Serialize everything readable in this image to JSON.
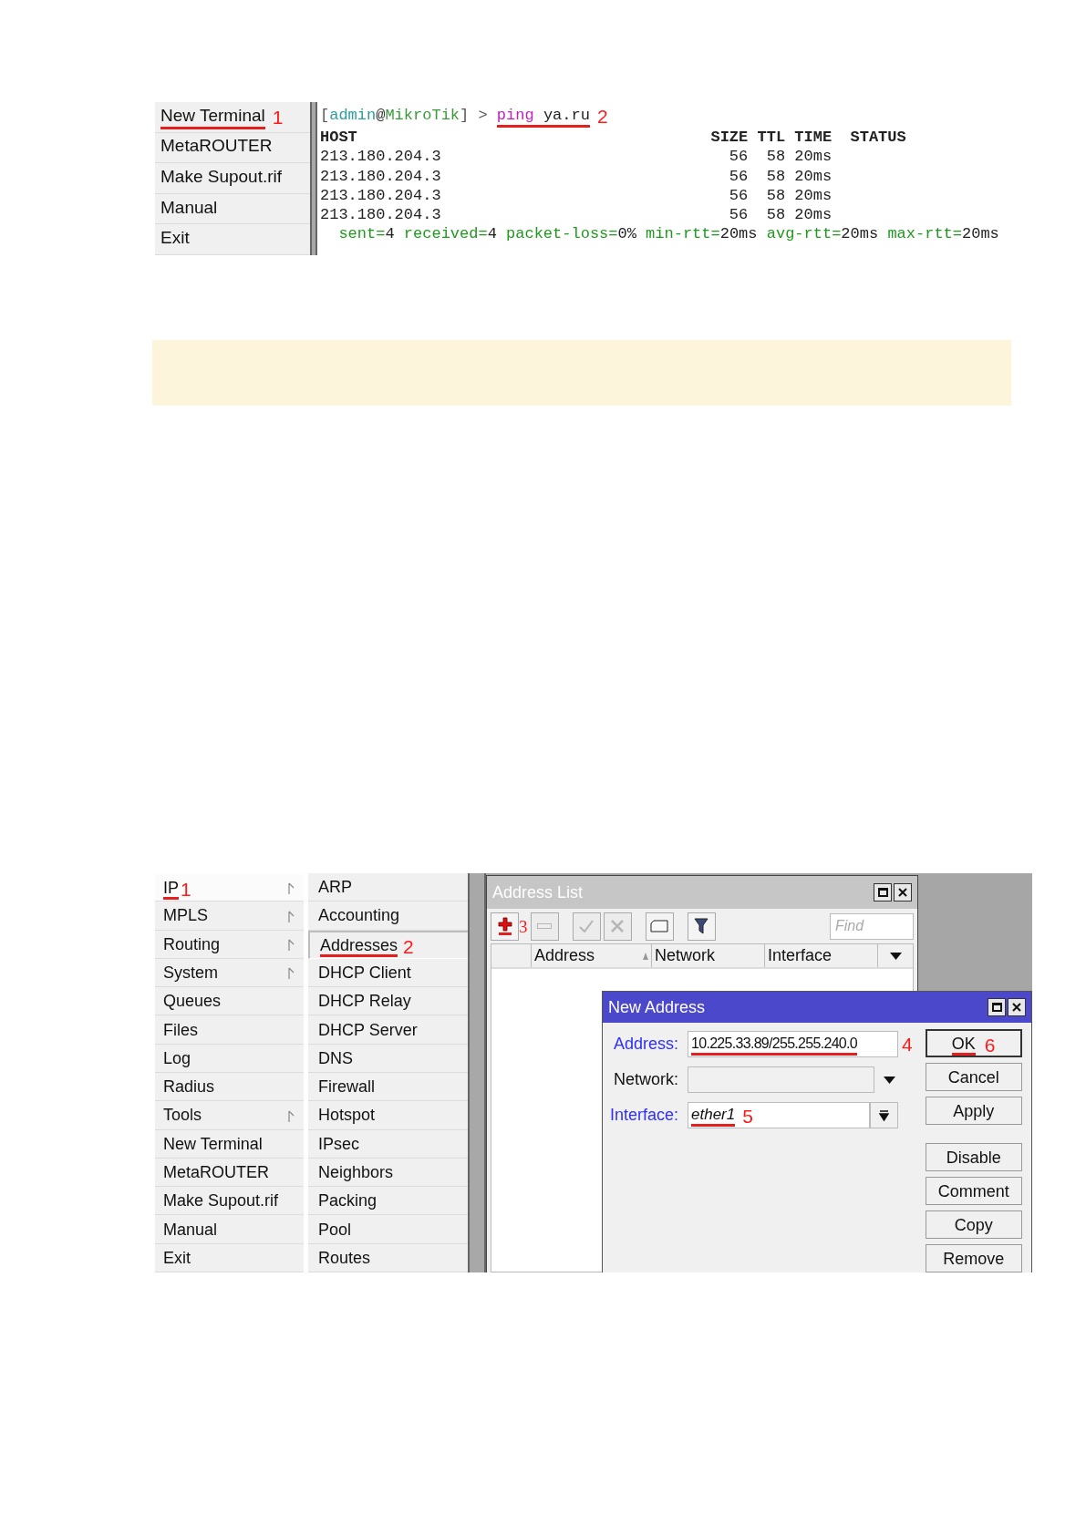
{
  "top_screenshot": {
    "menu": [
      {
        "label": "New Terminal",
        "underlined": true,
        "mark": "1"
      },
      {
        "label": "MetaROUTER",
        "underlined": false
      },
      {
        "label": "Make Supout.rif",
        "underlined": false
      },
      {
        "label": "Manual",
        "underlined": false
      },
      {
        "label": "Exit",
        "underlined": false
      }
    ],
    "terminal": {
      "prompt": [
        {
          "kind": "bracket",
          "text": "["
        },
        {
          "kind": "user",
          "text": "admin"
        },
        {
          "kind": "punct",
          "text": "@"
        },
        {
          "kind": "host",
          "text": "MikroTik"
        },
        {
          "kind": "bracket",
          "text": "] > "
        }
      ],
      "command": {
        "keyword": "ping",
        "argument": "ya.ru",
        "underlined": true,
        "mark": "2"
      },
      "columns": [
        "HOST",
        "SIZE",
        "TTL",
        "TIME",
        "STATUS"
      ],
      "rows": [
        {
          "host": "213.180.204.3",
          "size": "56",
          "ttl": "58",
          "time": "20ms"
        },
        {
          "host": "213.180.204.3",
          "size": "56",
          "ttl": "58",
          "time": "20ms"
        },
        {
          "host": "213.180.204.3",
          "size": "56",
          "ttl": "58",
          "time": "20ms"
        },
        {
          "host": "213.180.204.3",
          "size": "56",
          "ttl": "58",
          "time": "20ms"
        }
      ],
      "summary": [
        {
          "key": "sent=",
          "value": "4"
        },
        {
          "key": "received=",
          "value": "4"
        },
        {
          "key": "packet-loss=",
          "value": "0%"
        },
        {
          "key": "min-rtt=",
          "value": "20ms"
        },
        {
          "key": "avg-rtt=",
          "value": "20ms"
        },
        {
          "key": "max-rtt=",
          "value": "20ms"
        }
      ]
    }
  },
  "bottom_screenshot": {
    "menu": [
      {
        "label": "IP",
        "selected": true,
        "has_submenu": true,
        "underlined": true,
        "mark": "1"
      },
      {
        "label": "MPLS",
        "selected": false,
        "has_submenu": true,
        "underlined": false
      },
      {
        "label": "Routing",
        "selected": false,
        "has_submenu": true,
        "underlined": false
      },
      {
        "label": "System",
        "selected": false,
        "has_submenu": true,
        "underlined": false
      },
      {
        "label": "Queues",
        "selected": false,
        "has_submenu": false,
        "underlined": false
      },
      {
        "label": "Files",
        "selected": false,
        "has_submenu": false,
        "underlined": false
      },
      {
        "label": "Log",
        "selected": false,
        "has_submenu": false,
        "underlined": false
      },
      {
        "label": "Radius",
        "selected": false,
        "has_submenu": false,
        "underlined": false
      },
      {
        "label": "Tools",
        "selected": false,
        "has_submenu": true,
        "underlined": false
      },
      {
        "label": "New Terminal",
        "selected": false,
        "has_submenu": false,
        "underlined": false
      },
      {
        "label": "MetaROUTER",
        "selected": false,
        "has_submenu": false,
        "underlined": false
      },
      {
        "label": "Make Supout.rif",
        "selected": false,
        "has_submenu": false,
        "underlined": false
      },
      {
        "label": "Manual",
        "selected": false,
        "has_submenu": false,
        "underlined": false
      },
      {
        "label": "Exit",
        "selected": false,
        "has_submenu": false,
        "underlined": false
      }
    ],
    "submenu": [
      {
        "label": "ARP",
        "selected": false,
        "underlined": false
      },
      {
        "label": "Accounting",
        "selected": false,
        "underlined": false
      },
      {
        "label": "Addresses",
        "selected": true,
        "underlined": true,
        "mark": "2"
      },
      {
        "label": "DHCP Client",
        "selected": false,
        "underlined": false
      },
      {
        "label": "DHCP Relay",
        "selected": false,
        "underlined": false
      },
      {
        "label": "DHCP Server",
        "selected": false,
        "underlined": false
      },
      {
        "label": "DNS",
        "selected": false,
        "underlined": false
      },
      {
        "label": "Firewall",
        "selected": false,
        "underlined": false
      },
      {
        "label": "Hotspot",
        "selected": false,
        "underlined": false
      },
      {
        "label": "IPsec",
        "selected": false,
        "underlined": false
      },
      {
        "label": "Neighbors",
        "selected": false,
        "underlined": false
      },
      {
        "label": "Packing",
        "selected": false,
        "underlined": false
      },
      {
        "label": "Pool",
        "selected": false,
        "underlined": false
      },
      {
        "label": "Routes",
        "selected": false,
        "underlined": false
      }
    ],
    "address_list": {
      "title": "Address List",
      "toolbar": [
        {
          "kind": "add",
          "disabled": false,
          "underlined": true,
          "mark": "3"
        },
        {
          "kind": "remove",
          "disabled": true,
          "underlined": false
        },
        {
          "kind": "enable",
          "disabled": true,
          "underlined": false
        },
        {
          "kind": "disable",
          "disabled": true,
          "underlined": false
        },
        {
          "kind": "comment",
          "disabled": false,
          "underlined": false
        },
        {
          "kind": "filter",
          "disabled": false,
          "underlined": false
        }
      ],
      "find_placeholder": "Find",
      "columns": [
        {
          "label": "Address",
          "sorted": true
        },
        {
          "label": "Network",
          "sorted": false
        },
        {
          "label": "Interface",
          "sorted": false
        }
      ]
    },
    "new_address": {
      "title": "New Address",
      "fields": [
        {
          "kind": "text",
          "label": "Address:",
          "highlighted": true,
          "value": "10.225.33.89/255.255.240.0",
          "underlined": true,
          "mark": "4"
        },
        {
          "kind": "dropdown",
          "label": "Network:",
          "highlighted": false
        },
        {
          "kind": "select",
          "label": "Interface:",
          "highlighted": true,
          "value": "ether1",
          "underlined": true,
          "mark": "5"
        }
      ],
      "primary_buttons": [
        {
          "label": "OK",
          "default": true,
          "underlined": true,
          "mark": "6"
        },
        {
          "label": "Cancel",
          "default": false,
          "underlined": false
        },
        {
          "label": "Apply",
          "default": false,
          "underlined": false
        }
      ],
      "secondary_buttons": [
        {
          "label": "Disable",
          "default": false,
          "underlined": false
        },
        {
          "label": "Comment",
          "default": false,
          "underlined": false
        },
        {
          "label": "Copy",
          "default": false,
          "underlined": false
        },
        {
          "label": "Remove",
          "default": false,
          "underlined": false
        }
      ]
    }
  }
}
